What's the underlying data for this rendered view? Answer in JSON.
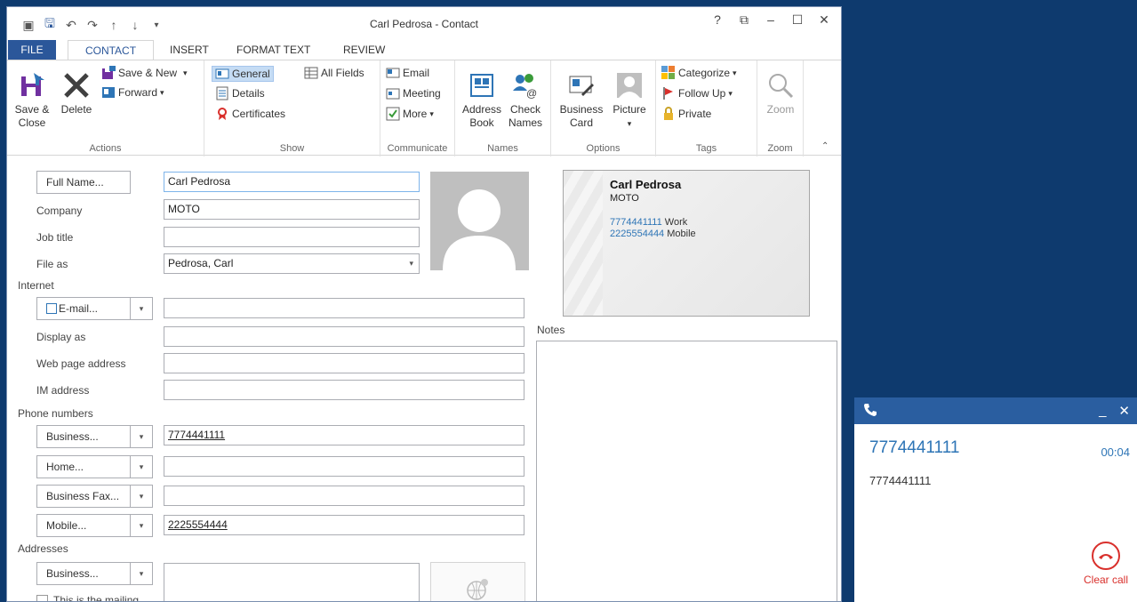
{
  "window": {
    "title": "Carl Pedrosa - Contact",
    "controls": [
      "?",
      "⧉",
      "–",
      "☐",
      "✕"
    ]
  },
  "tabs": [
    "FILE",
    "CONTACT",
    "INSERT",
    "FORMAT TEXT",
    "REVIEW"
  ],
  "ribbon": {
    "actions": {
      "label": "Actions",
      "save_close": "Save & Close",
      "save_close_l1": "Save &",
      "save_close_l2": "Close",
      "delete": "Delete",
      "save_new": "Save & New",
      "forward": "Forward"
    },
    "show": {
      "label": "Show",
      "general": "General",
      "details": "Details",
      "certificates": "Certificates",
      "all_fields": "All Fields"
    },
    "communicate": {
      "label": "Communicate",
      "email": "Email",
      "meeting": "Meeting",
      "more": "More"
    },
    "names": {
      "label": "Names",
      "address_book_l1": "Address",
      "address_book_l2": "Book",
      "check_names_l1": "Check",
      "check_names_l2": "Names"
    },
    "options": {
      "label": "Options",
      "business_card_l1": "Business",
      "business_card_l2": "Card",
      "picture": "Picture"
    },
    "tags": {
      "label": "Tags",
      "categorize": "Categorize",
      "follow_up": "Follow Up",
      "private": "Private"
    },
    "zoom": {
      "label": "Zoom",
      "zoom": "Zoom"
    }
  },
  "form": {
    "full_name_btn": "Full Name...",
    "full_name": "Carl Pedrosa",
    "company_label": "Company",
    "company": "MOTO",
    "job_title_label": "Job title",
    "job_title": "",
    "file_as_label": "File as",
    "file_as": "Pedrosa, Carl",
    "internet_label": "Internet",
    "email_btn": "E-mail...",
    "email": "",
    "display_as_label": "Display as",
    "web_label": "Web page address",
    "im_label": "IM address",
    "phone_label": "Phone numbers",
    "phones": [
      {
        "type": "Business...",
        "value": "7774441111"
      },
      {
        "type": "Home...",
        "value": ""
      },
      {
        "type": "Business Fax...",
        "value": ""
      },
      {
        "type": "Mobile...",
        "value": "2225554444"
      }
    ],
    "addresses_label": "Addresses",
    "address_btn": "Business...",
    "mailing_check": "This is the mailing",
    "notes_label": "Notes"
  },
  "card": {
    "name": "Carl Pedrosa",
    "company": "MOTO",
    "phone1": "7774441111",
    "phone1_type": "Work",
    "phone2": "2225554444",
    "phone2_type": "Mobile"
  },
  "call": {
    "number": "7774441111",
    "timer": "00:04",
    "caller": "7774441111",
    "clear": "Clear call"
  }
}
